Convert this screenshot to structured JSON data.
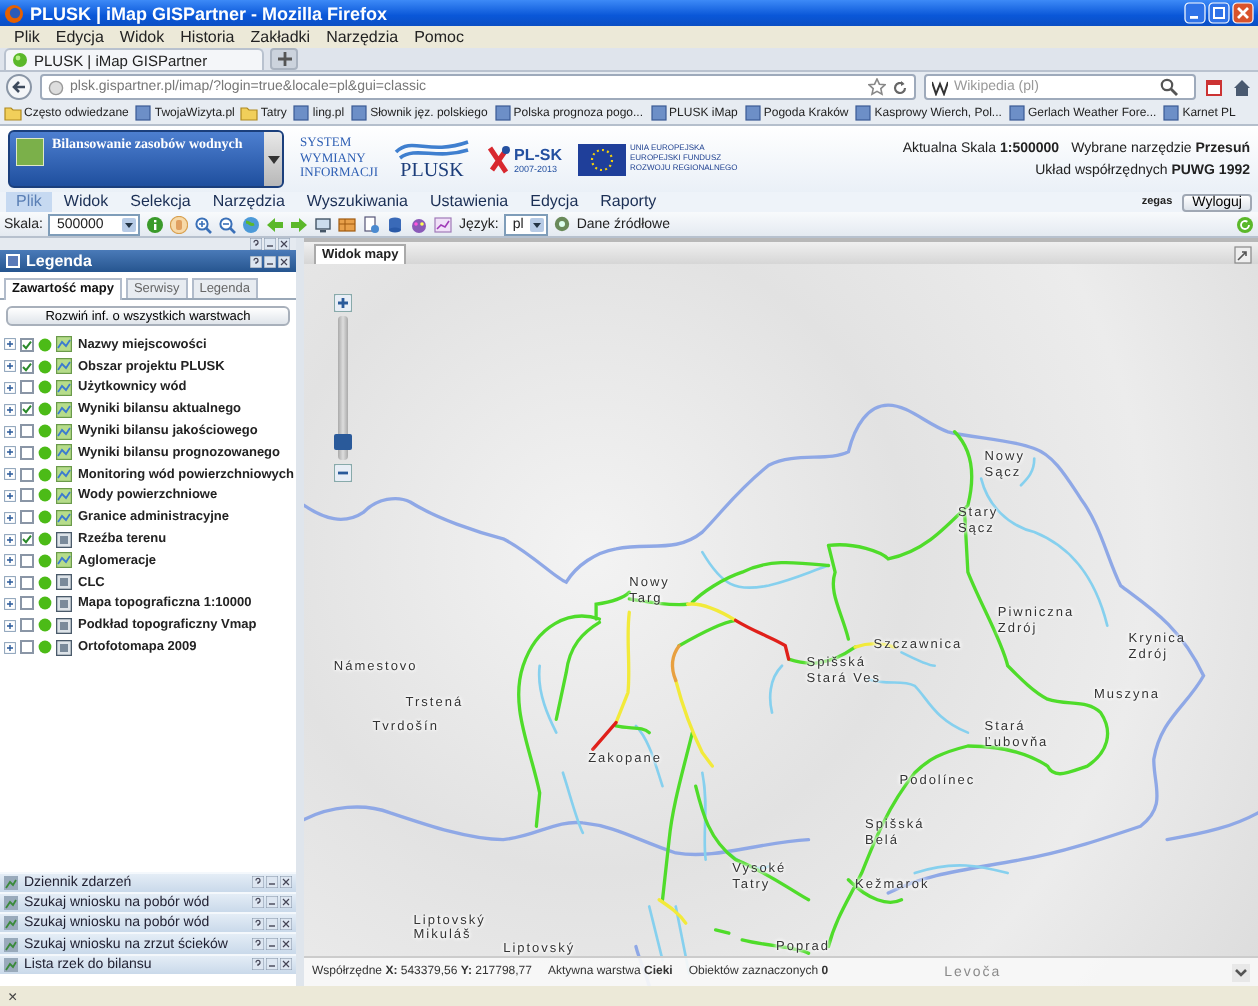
{
  "browser": {
    "title": "PLUSK | iMap GISPartner - Mozilla Firefox",
    "menu": [
      "Plik",
      "Edycja",
      "Widok",
      "Historia",
      "Zakładki",
      "Narzędzia",
      "Pomoc"
    ],
    "tab": "PLUSK | iMap GISPartner",
    "url": "plsk.gispartner.pl/imap/?login=true&locale=pl&gui=classic",
    "search_placeholder": "Wikipedia (pl)",
    "bookmarks": [
      {
        "label": "Często odwiedzane",
        "kind": "folder"
      },
      {
        "label": "TwojaWizyta.pl",
        "kind": "page"
      },
      {
        "label": "Tatry",
        "kind": "folder"
      },
      {
        "label": "ling.pl",
        "kind": "page"
      },
      {
        "label": "Słownik jęz. polskiego",
        "kind": "page"
      },
      {
        "label": "Polska prognoza pogo...",
        "kind": "page"
      },
      {
        "label": "PLUSK iMap",
        "kind": "page"
      },
      {
        "label": "Pogoda Kraków",
        "kind": "page"
      },
      {
        "label": "Kasprowy Wierch, Pol...",
        "kind": "page"
      },
      {
        "label": "Gerlach Weather Fore...",
        "kind": "page"
      },
      {
        "label": "Karnet PL",
        "kind": "page"
      }
    ]
  },
  "app": {
    "product": "Bilansowanie zasobów wodnych",
    "system_logo": "SYSTEM WYMIANY INFORMACJI",
    "plusk_logo": "PLUSK",
    "plsk_logo": "PL-SK",
    "plsk_years": "2007-2013",
    "eu_logo": [
      "UNIA EUROPEJSKA",
      "EUROPEJSKI FUNDUSZ",
      "ROZWOJU REGIONALNEGO"
    ],
    "info_lines": [
      [
        {
          "label": "Aktualna Skala",
          "value": "1:500000"
        },
        {
          "label": "Wybrane narzędzie",
          "value": "Przesuń"
        }
      ],
      [
        {
          "label": "Układ współrzędnych",
          "value": "PUWG 1992"
        }
      ]
    ],
    "menu": [
      {
        "label": "Plik",
        "selected": true
      },
      {
        "label": "Widok",
        "selected": false
      },
      {
        "label": "Selekcja",
        "selected": false
      },
      {
        "label": "Narzędzia",
        "selected": false
      },
      {
        "label": "Wyszukiwania",
        "selected": false
      },
      {
        "label": "Ustawienia",
        "selected": false
      },
      {
        "label": "Edycja",
        "selected": false
      },
      {
        "label": "Raporty",
        "selected": false
      }
    ],
    "user": "zegas",
    "logout": "Wyloguj"
  },
  "toolbar": {
    "scale_label": "Skala:",
    "scale": "500000",
    "language_label": "Język:",
    "language": "pl",
    "sources": "Dane źródłowe"
  },
  "legend": {
    "title": "Legenda",
    "tabs": [
      {
        "label": "Zawartość mapy",
        "selected": true
      },
      {
        "label": "Serwisy",
        "selected": false
      },
      {
        "label": "Legenda",
        "selected": false
      }
    ],
    "expand_button": "Rozwiń inf. o wszystkich warstwach",
    "layers": [
      {
        "name": "Nazwy miejscowości",
        "checked": true,
        "kind": "vector"
      },
      {
        "name": "Obszar projektu PLUSK",
        "checked": true,
        "kind": "vector"
      },
      {
        "name": "Użytkownicy wód",
        "checked": false,
        "kind": "vector"
      },
      {
        "name": "Wyniki bilansu aktualnego",
        "checked": true,
        "kind": "vector"
      },
      {
        "name": "Wyniki bilansu jakościowego",
        "checked": false,
        "kind": "vector"
      },
      {
        "name": "Wyniki bilansu prognozowanego",
        "checked": false,
        "kind": "vector"
      },
      {
        "name": "Monitoring wód powierzchniowych",
        "checked": false,
        "kind": "vector"
      },
      {
        "name": "Wody powierzchniowe",
        "checked": false,
        "kind": "vector"
      },
      {
        "name": "Granice administracyjne",
        "checked": false,
        "kind": "vector"
      },
      {
        "name": "Rzeźba terenu",
        "checked": true,
        "kind": "raster"
      },
      {
        "name": "Aglomeracje",
        "checked": false,
        "kind": "vector"
      },
      {
        "name": "CLC",
        "checked": false,
        "kind": "raster"
      },
      {
        "name": "Mapa topograficzna 1:10000",
        "checked": false,
        "kind": "raster"
      },
      {
        "name": "Podkład topograficzny Vmap",
        "checked": false,
        "kind": "raster"
      },
      {
        "name": "Ortofotomapa 2009",
        "checked": false,
        "kind": "raster"
      }
    ]
  },
  "bottom_panels": [
    "Dziennik zdarzeń",
    "Szukaj wniosku na pobór wód",
    "Szukaj wniosku na pobór wód",
    "Szukaj wniosku na zrzut ścieków",
    "Lista rzek do bilansu"
  ],
  "map": {
    "tab": "Widok mapy",
    "zoom_slider": {
      "level": 0.08
    },
    "labels": [
      "Nowy\nSącz",
      "Stary\nSącz",
      "Nowy\nTarg",
      "Piwniczna\nZdrój",
      "Szczawnica",
      "Krynica\nZdrój",
      "Námestovo",
      "Spišská\nStará Ves",
      "Trstená",
      "Muszyna",
      "Tvrdošín",
      "Zakopane",
      "Stará\nĽubovňa",
      "Podolínec",
      "Spišská\nBelá",
      "Vysoké\nTatry",
      "Kežmarok",
      "Liptovský\nMikuláš",
      "Poprad",
      "Liptovský"
    ],
    "status": [
      "Współrzędne **X:** 543379,56 **Y:** 217798,77",
      "Aktywna warstwa **Cieki**",
      "Obiektów zaznaczonych **0**"
    ],
    "faint_label": "Levoča"
  },
  "statusbar_close": "×"
}
